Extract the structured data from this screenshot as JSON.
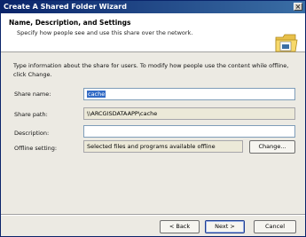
{
  "window": {
    "title": "Create A Shared Folder Wizard",
    "close_glyph": "×"
  },
  "header": {
    "title": "Name, Description, and Settings",
    "subtitle": "Specify how people see and use this share over the network."
  },
  "intro_text": "Type information about the share for users. To modify how people use the content while offline, click Change.",
  "form": {
    "share_name_label": "Share name:",
    "share_name_value": "cache",
    "share_path_label": "Share path:",
    "share_path_value": "\\\\ARCGISDATAAPP\\cache",
    "description_label": "Description:",
    "description_value": "",
    "offline_label": "Offline setting:",
    "offline_value": "Selected files and programs available offline",
    "change_button": "Change..."
  },
  "buttons": {
    "back": "< Back",
    "next": "Next >",
    "cancel": "Cancel"
  }
}
